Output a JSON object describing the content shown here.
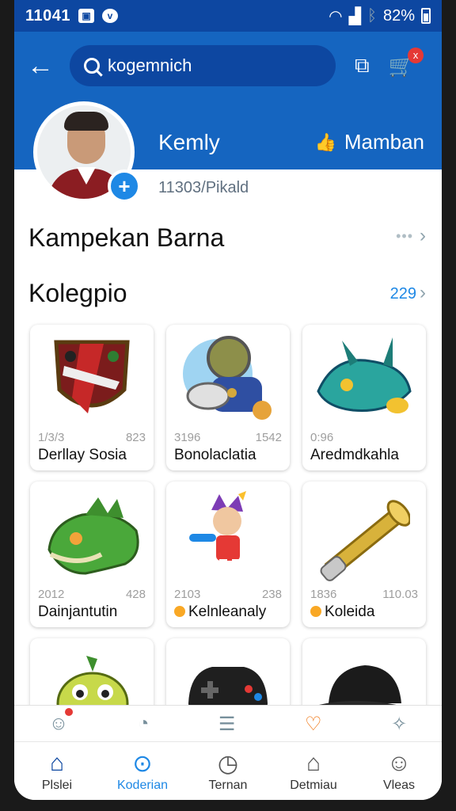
{
  "status_bar": {
    "time": "11041",
    "battery": "82%"
  },
  "header": {
    "search_text": "kogemnich",
    "cart_badge": "x"
  },
  "profile": {
    "name": "Kemly",
    "member_label": "Mamban",
    "user_id": "11303/Pikald"
  },
  "sections": {
    "recent": {
      "title": "Kampekan Barna",
      "more": "•••"
    },
    "collection": {
      "title": "Kolegpio",
      "count": "229"
    }
  },
  "cards": [
    {
      "stat_left": "1/3/3",
      "stat_right": "823",
      "name": "Derllay Sosia",
      "coin": false,
      "art": "shield"
    },
    {
      "stat_left": "3196",
      "stat_right": "1542",
      "name": "Bonolaclatia",
      "coin": false,
      "art": "astronaut"
    },
    {
      "stat_left": "0:96",
      "stat_right": "",
      "name": "Aredmdkahla",
      "coin": false,
      "art": "creature"
    },
    {
      "stat_left": "2012",
      "stat_right": "428",
      "name": "Dainjantutin",
      "coin": false,
      "art": "dragon"
    },
    {
      "stat_left": "2103",
      "stat_right": "238",
      "name": "Kelnleanaly",
      "coin": true,
      "art": "hero"
    },
    {
      "stat_left": "1836",
      "stat_right": "110.03",
      "name": "Koleida",
      "coin": true,
      "art": "cannon"
    },
    {
      "stat_left": "",
      "stat_right": "",
      "name": "",
      "coin": false,
      "art": "frog"
    },
    {
      "stat_left": "",
      "stat_right": "",
      "name": "",
      "coin": false,
      "art": "gamepad"
    },
    {
      "stat_left": "",
      "stat_right": "",
      "name": "",
      "coin": false,
      "art": "cap"
    }
  ],
  "bottom_nav": [
    {
      "label": "Plslei",
      "icon": "home-icon"
    },
    {
      "label": "Koderian",
      "icon": "search-icon"
    },
    {
      "label": "Ternan",
      "icon": "clock-icon"
    },
    {
      "label": "Detmiau",
      "icon": "notice-icon"
    },
    {
      "label": "Vleas",
      "icon": "profile-icon"
    }
  ],
  "colors": {
    "primary": "#1565c0",
    "primary_dark": "#0d47a1",
    "accent": "#1e88e5",
    "badge": "#e53935"
  }
}
